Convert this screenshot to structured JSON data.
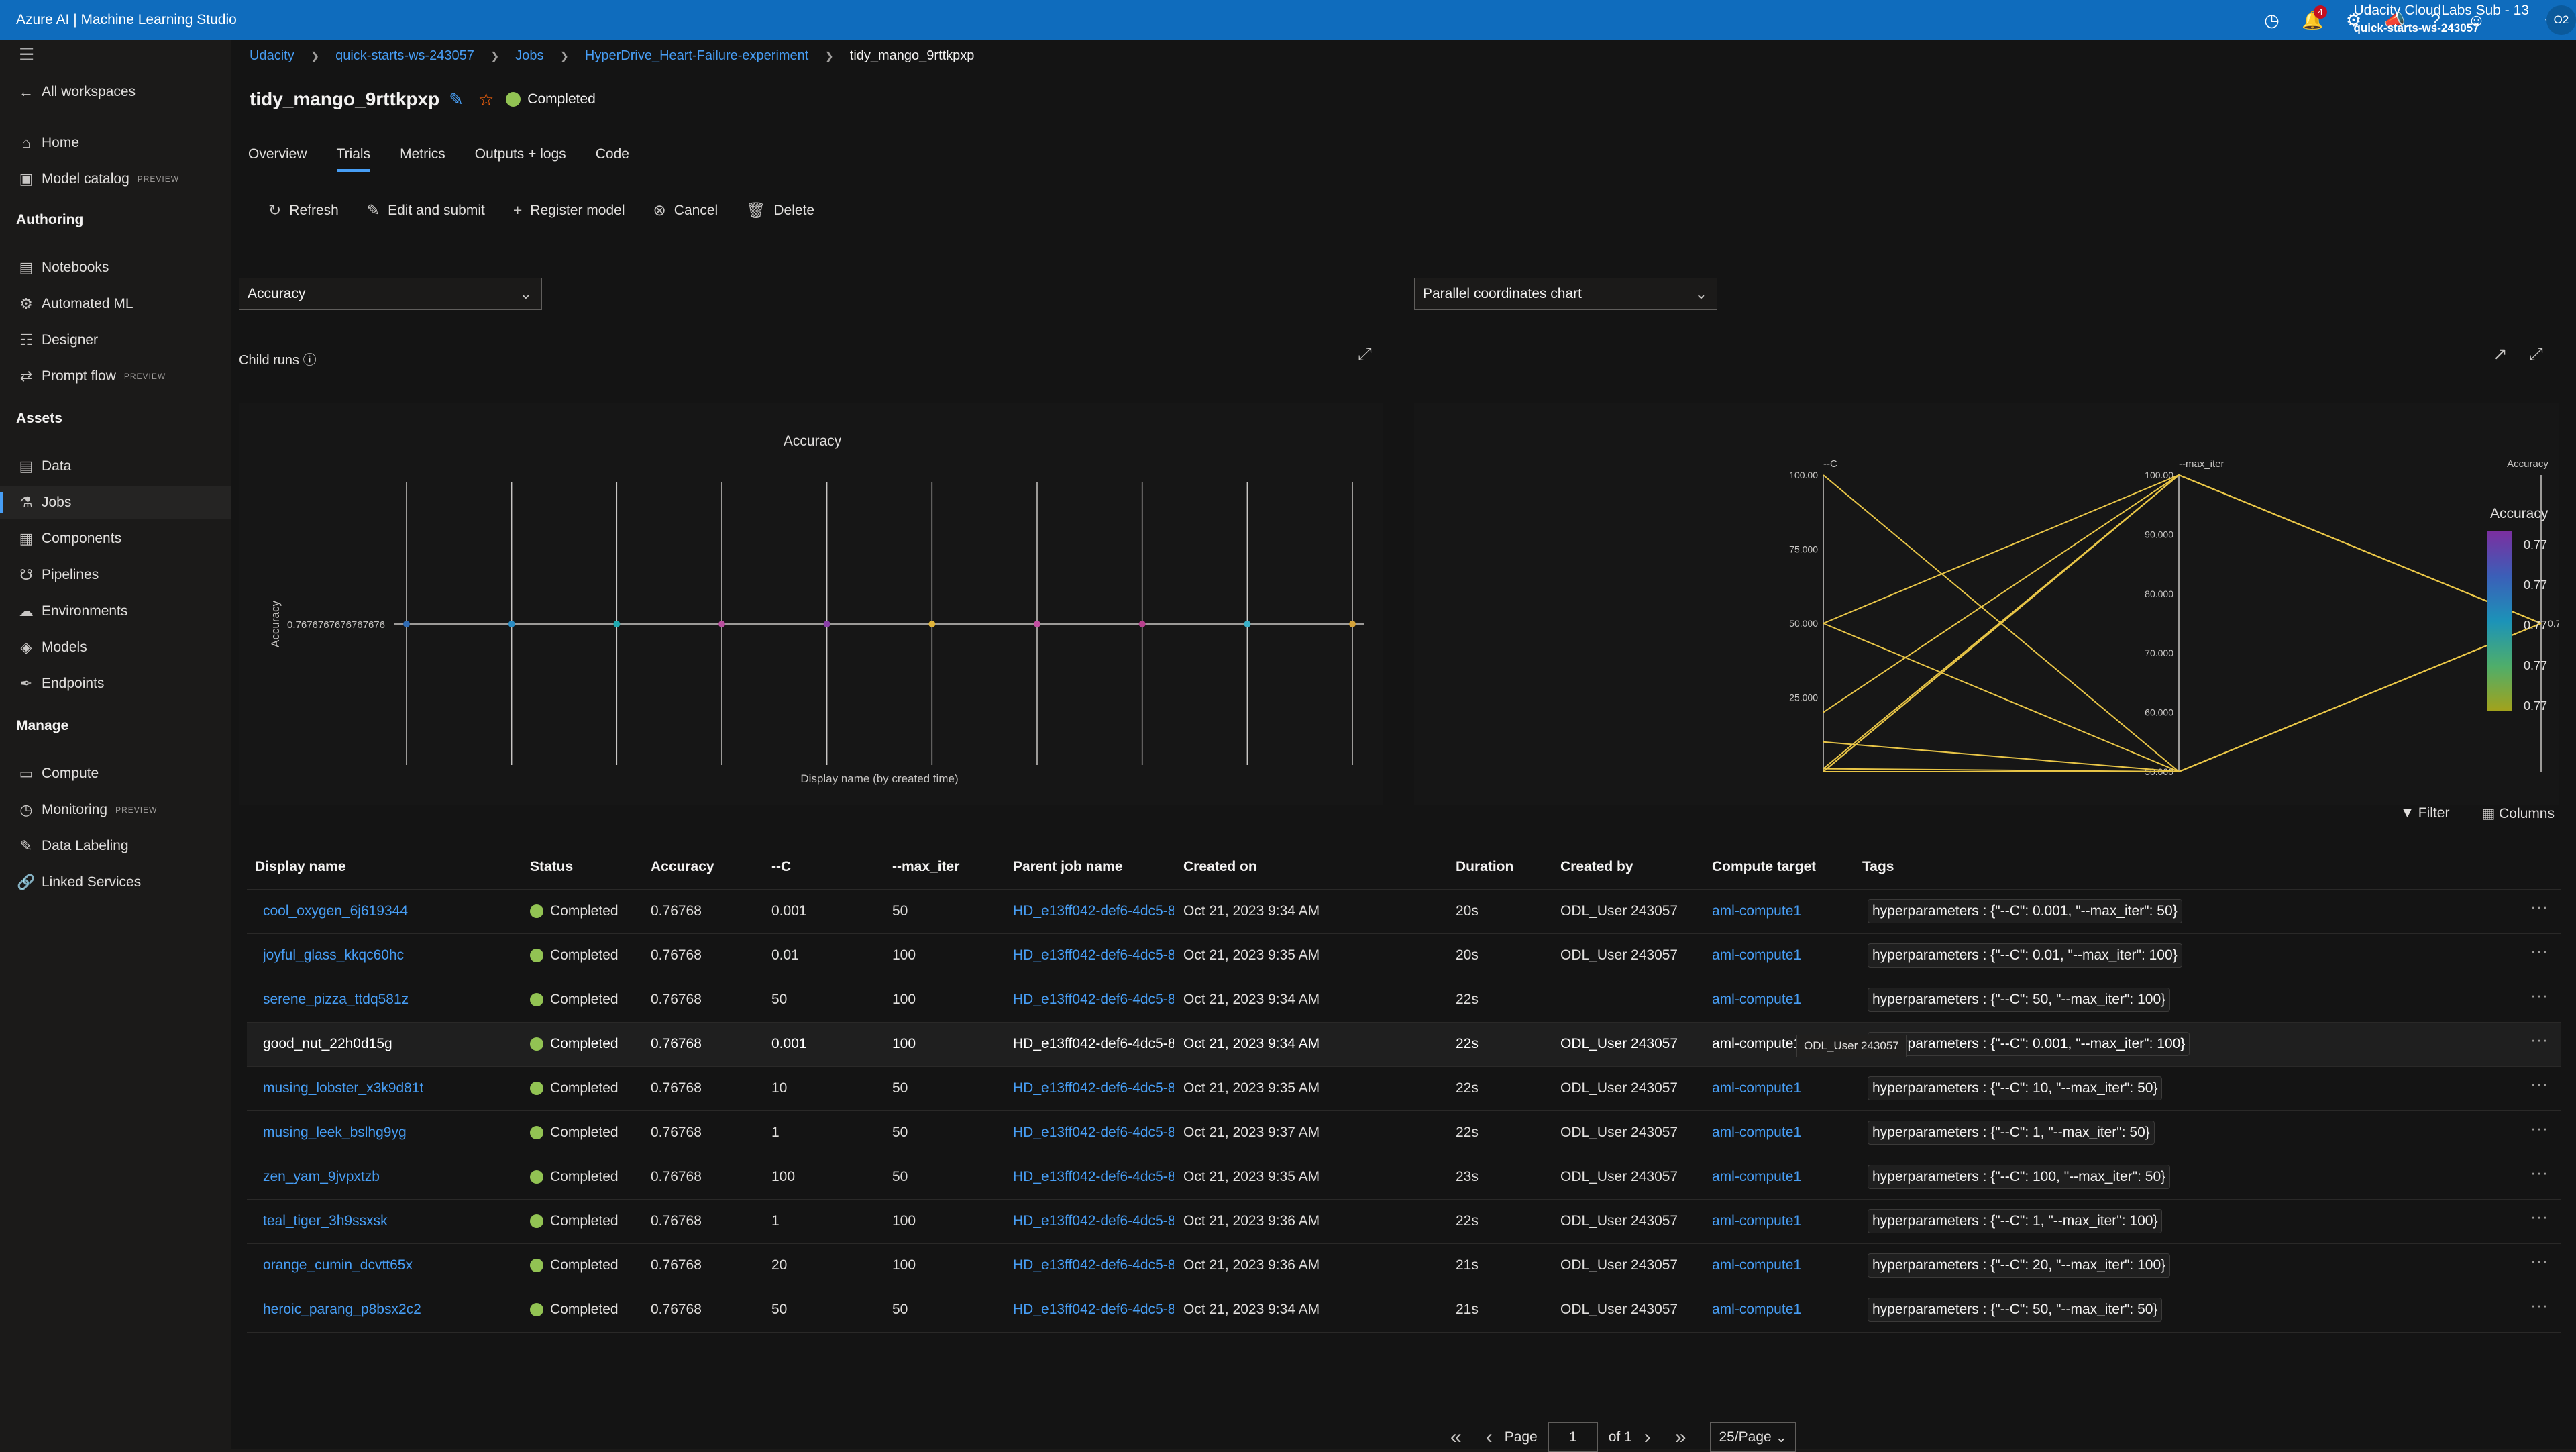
{
  "app": {
    "title": "Azure AI | Machine Learning Studio"
  },
  "topbar": {
    "notification_count": "4",
    "account_name": "Udacity CloudLabs Sub - 13",
    "account_workspace": "quick-starts-ws-243057",
    "avatar_initials": "O2"
  },
  "sidebar": {
    "back_label": "All workspaces",
    "items_top": [
      {
        "label": "Home",
        "icon": "home-icon"
      },
      {
        "label": "Model catalog",
        "badge": "PREVIEW",
        "icon": "catalog-icon"
      }
    ],
    "authoring_heading": "Authoring",
    "authoring": [
      {
        "label": "Notebooks"
      },
      {
        "label": "Automated ML"
      },
      {
        "label": "Designer"
      },
      {
        "label": "Prompt flow",
        "badge": "PREVIEW"
      }
    ],
    "assets_heading": "Assets",
    "assets": [
      {
        "label": "Data"
      },
      {
        "label": "Jobs"
      },
      {
        "label": "Components"
      },
      {
        "label": "Pipelines"
      },
      {
        "label": "Environments"
      },
      {
        "label": "Models"
      },
      {
        "label": "Endpoints"
      }
    ],
    "manage_heading": "Manage",
    "manage": [
      {
        "label": "Compute"
      },
      {
        "label": "Monitoring",
        "badge": "PREVIEW"
      },
      {
        "label": "Data Labeling"
      },
      {
        "label": "Linked Services"
      }
    ]
  },
  "breadcrumb": [
    "Udacity",
    "quick-starts-ws-243057",
    "Jobs",
    "HyperDrive_Heart-Failure-experiment",
    "tidy_mango_9rttkpxp"
  ],
  "job": {
    "name": "tidy_mango_9rttkpxp",
    "status": "Completed"
  },
  "tabs": [
    "Overview",
    "Trials",
    "Metrics",
    "Outputs + logs",
    "Code"
  ],
  "toolbar": {
    "refresh": "Refresh",
    "edit_submit": "Edit and submit",
    "register": "Register model",
    "cancel": "Cancel",
    "delete": "Delete"
  },
  "metric_dropdown": "Accuracy",
  "chart_dropdown": "Parallel coordinates chart",
  "child_runs_label": "Child runs",
  "chart_data": [
    {
      "type": "scatter",
      "title": "Accuracy",
      "xlabel": "Display name (by created time)",
      "ylabel": "Accuracy",
      "y_tick_labels": [
        "0.7676767676767676"
      ],
      "values": [
        0.7676767676767676,
        0.7676767676767676,
        0.7676767676767676,
        0.7676767676767676,
        0.7676767676767676,
        0.7676767676767676,
        0.7676767676767676,
        0.7676767676767676,
        0.7676767676767676,
        0.7676767676767676
      ],
      "point_colors": [
        "#2f6bb3",
        "#2a8cc4",
        "#1fa8b0",
        "#b94f9e",
        "#8a3fa8",
        "#e0b43a",
        "#c24fa2",
        "#b83f8e",
        "#3ab0c8",
        "#d4a33a"
      ]
    },
    {
      "type": "parallel-coordinates",
      "axes": [
        {
          "label": "--C",
          "ylim": [
            0,
            100
          ],
          "ticks": [
            "100.00",
            "75.000",
            "50.000",
            "25.000"
          ]
        },
        {
          "label": "--max_iter",
          "ylim": [
            50,
            100
          ],
          "ticks": [
            "100.00",
            "90.000",
            "80.000",
            "70.000",
            "60.000",
            "50.000"
          ]
        },
        {
          "label": "Accuracy",
          "ticks": [
            "0.77"
          ]
        }
      ],
      "lines": [
        {
          "C": 0.001,
          "max_iter": 50,
          "accuracy": 0.77
        },
        {
          "C": 0.01,
          "max_iter": 100,
          "accuracy": 0.77
        },
        {
          "C": 50,
          "max_iter": 100,
          "accuracy": 0.77
        },
        {
          "C": 0.001,
          "max_iter": 100,
          "accuracy": 0.77
        },
        {
          "C": 10,
          "max_iter": 50,
          "accuracy": 0.77
        },
        {
          "C": 1,
          "max_iter": 50,
          "accuracy": 0.77
        },
        {
          "C": 100,
          "max_iter": 50,
          "accuracy": 0.77
        },
        {
          "C": 1,
          "max_iter": 100,
          "accuracy": 0.77
        },
        {
          "C": 20,
          "max_iter": 100,
          "accuracy": 0.77
        },
        {
          "C": 50,
          "max_iter": 50,
          "accuracy": 0.77
        }
      ],
      "line_color": "#e8c547",
      "legend": {
        "title": "Accuracy",
        "labels": [
          "0.77",
          "0.77",
          "0.77",
          "0.77",
          "0.77"
        ],
        "gradient": [
          "#7b2fa0",
          "#3b5fb8",
          "#1c93b8",
          "#4fae6a",
          "#a3a21b"
        ]
      }
    }
  ],
  "table_actions": {
    "filter": "Filter",
    "columns": "Columns"
  },
  "columns": [
    "Display name",
    "Status",
    "Accuracy",
    "--C",
    "--max_iter",
    "Parent job name",
    "Created on",
    "Duration",
    "Created by",
    "Compute target",
    "Tags"
  ],
  "rows": [
    {
      "name": "cool_oxygen_6j619344",
      "status": "Completed",
      "accuracy": "0.76768",
      "c": "0.001",
      "max_iter": "50",
      "parent": "HD_e13ff042-def6-4dc5-8",
      "created": "Oct 21, 2023 9:34 AM",
      "duration": "20s",
      "by": "ODL_User 243057",
      "compute": "aml-compute1",
      "tags": "hyperparameters : {\"--C\": 0.001, \"--max_iter\": 50}"
    },
    {
      "name": "joyful_glass_kkqc60hc",
      "status": "Completed",
      "accuracy": "0.76768",
      "c": "0.01",
      "max_iter": "100",
      "parent": "HD_e13ff042-def6-4dc5-8",
      "created": "Oct 21, 2023 9:35 AM",
      "duration": "20s",
      "by": "ODL_User 243057",
      "compute": "aml-compute1",
      "tags": "hyperparameters : {\"--C\": 0.01, \"--max_iter\": 100}"
    },
    {
      "name": "serene_pizza_ttdq581z",
      "status": "Completed",
      "accuracy": "0.76768",
      "c": "50",
      "max_iter": "100",
      "parent": "HD_e13ff042-def6-4dc5-8",
      "created": "Oct 21, 2023 9:34 AM",
      "duration": "22s",
      "by": "",
      "compute": "aml-compute1",
      "tags": "hyperparameters : {\"--C\": 50, \"--max_iter\": 100}"
    },
    {
      "name": "good_nut_22h0d15g",
      "status": "Completed",
      "accuracy": "0.76768",
      "c": "0.001",
      "max_iter": "100",
      "parent": "HD_e13ff042-def6-4dc5-8",
      "created": "Oct 21, 2023 9:34 AM",
      "duration": "22s",
      "by": "ODL_User 243057",
      "compute": "aml-compute1",
      "tags": "hyperparameters : {\"--C\": 0.001, \"--max_iter\": 100}"
    },
    {
      "name": "musing_lobster_x3k9d81t",
      "status": "Completed",
      "accuracy": "0.76768",
      "c": "10",
      "max_iter": "50",
      "parent": "HD_e13ff042-def6-4dc5-8",
      "created": "Oct 21, 2023 9:35 AM",
      "duration": "22s",
      "by": "ODL_User 243057",
      "compute": "aml-compute1",
      "tags": "hyperparameters : {\"--C\": 10, \"--max_iter\": 50}"
    },
    {
      "name": "musing_leek_bslhg9yg",
      "status": "Completed",
      "accuracy": "0.76768",
      "c": "1",
      "max_iter": "50",
      "parent": "HD_e13ff042-def6-4dc5-8",
      "created": "Oct 21, 2023 9:37 AM",
      "duration": "22s",
      "by": "ODL_User 243057",
      "compute": "aml-compute1",
      "tags": "hyperparameters : {\"--C\": 1, \"--max_iter\": 50}"
    },
    {
      "name": "zen_yam_9jvpxtzb",
      "status": "Completed",
      "accuracy": "0.76768",
      "c": "100",
      "max_iter": "50",
      "parent": "HD_e13ff042-def6-4dc5-8",
      "created": "Oct 21, 2023 9:35 AM",
      "duration": "23s",
      "by": "ODL_User 243057",
      "compute": "aml-compute1",
      "tags": "hyperparameters : {\"--C\": 100, \"--max_iter\": 50}"
    },
    {
      "name": "teal_tiger_3h9ssxsk",
      "status": "Completed",
      "accuracy": "0.76768",
      "c": "1",
      "max_iter": "100",
      "parent": "HD_e13ff042-def6-4dc5-8",
      "created": "Oct 21, 2023 9:36 AM",
      "duration": "22s",
      "by": "ODL_User 243057",
      "compute": "aml-compute1",
      "tags": "hyperparameters : {\"--C\": 1, \"--max_iter\": 100}"
    },
    {
      "name": "orange_cumin_dcvtt65x",
      "status": "Completed",
      "accuracy": "0.76768",
      "c": "20",
      "max_iter": "100",
      "parent": "HD_e13ff042-def6-4dc5-8",
      "created": "Oct 21, 2023 9:36 AM",
      "duration": "21s",
      "by": "ODL_User 243057",
      "compute": "aml-compute1",
      "tags": "hyperparameters : {\"--C\": 20, \"--max_iter\": 100}"
    },
    {
      "name": "heroic_parang_p8bsx2c2",
      "status": "Completed",
      "accuracy": "0.76768",
      "c": "50",
      "max_iter": "50",
      "parent": "HD_e13ff042-def6-4dc5-8",
      "created": "Oct 21, 2023 9:34 AM",
      "duration": "21s",
      "by": "ODL_User 243057",
      "compute": "aml-compute1",
      "tags": "hyperparameters : {\"--C\": 50, \"--max_iter\": 50}"
    }
  ],
  "tooltip": "ODL_User 243057",
  "pager": {
    "page_label": "Page",
    "page": "1",
    "of_label": "of 1",
    "per_page": "25/Page"
  }
}
